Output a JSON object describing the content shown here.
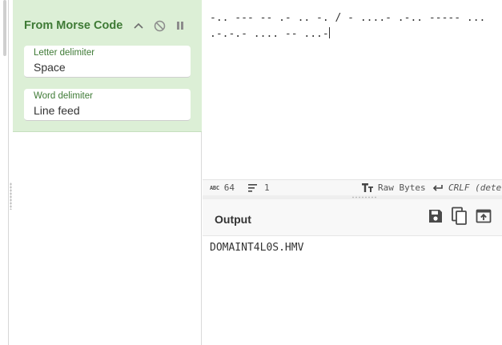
{
  "operation": {
    "title": "From Morse Code",
    "letter_delimiter": {
      "label": "Letter delimiter",
      "value": "Space"
    },
    "word_delimiter": {
      "label": "Word delimiter",
      "value": "Line feed"
    }
  },
  "input": {
    "text": "-.. --- -- .- .. -. / - ....- .-.. ----- ... .-.-.- .... -- ...-"
  },
  "status": {
    "char_count": "64",
    "line_count": "1",
    "raw_bytes_label": "Raw Bytes",
    "eol_label": "CRLF (detec"
  },
  "output": {
    "title": "Output",
    "text": "DOMAINT4L0S.HMV"
  },
  "icons": {
    "collapse": "chevron-up-icon",
    "disable": "disable-icon",
    "pause": "pause-icon",
    "save": "save-icon",
    "copy": "copy-icon",
    "replace_input": "replace-input-icon",
    "maximise": "maximise-icon"
  },
  "colors": {
    "operation_bg": "#dcefd6",
    "operation_title": "#3e7a35"
  }
}
